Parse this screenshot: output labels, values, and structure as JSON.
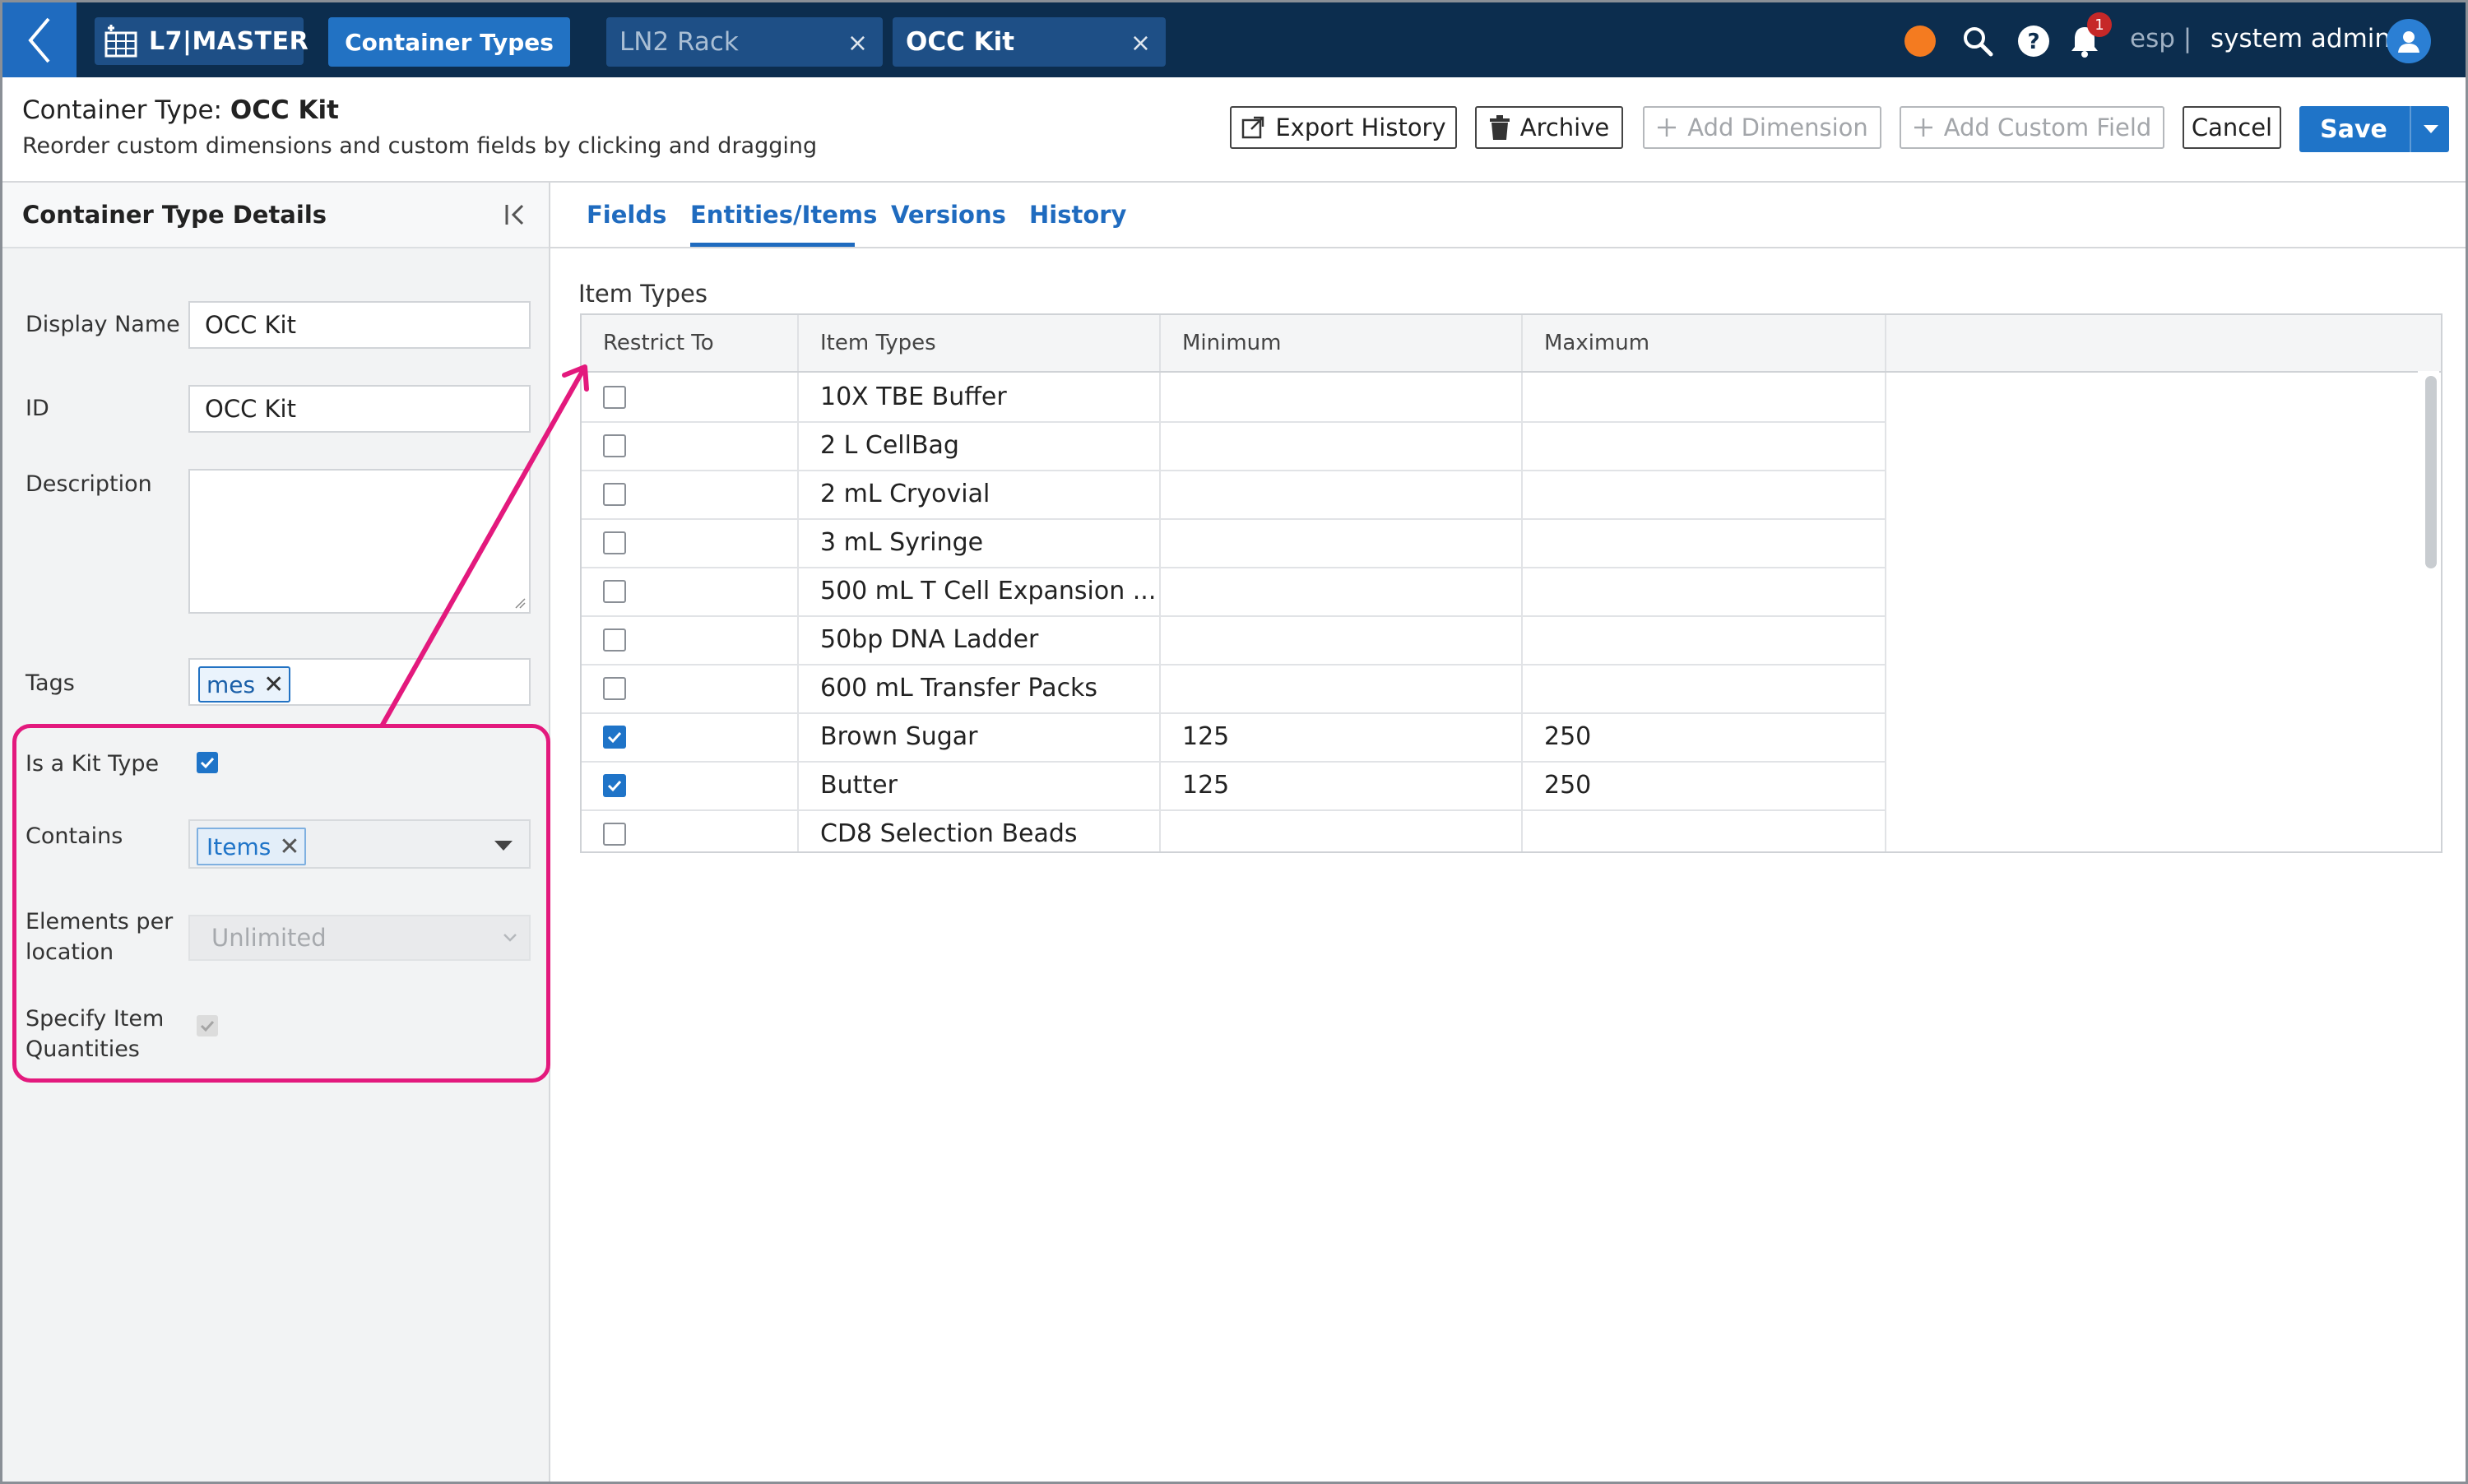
{
  "topbar": {
    "app_name": "L7|MASTER",
    "nav_tab": "Container Types",
    "open_tabs": [
      {
        "label": "LN2 Rack"
      },
      {
        "label": "OCC Kit"
      }
    ],
    "close_glyph": "×",
    "notification_count": "1",
    "workspace": "esp |",
    "user_name": "system admin",
    "icons": [
      "back-chevron-icon",
      "grid-logo-icon",
      "status-dot-icon",
      "search-icon",
      "help-icon",
      "bell-icon",
      "user-avatar-icon"
    ]
  },
  "header": {
    "title_prefix": "Container Type:",
    "title_name": "OCC Kit",
    "subtitle": "Reorder custom dimensions and custom fields by clicking and dragging",
    "buttons": {
      "export_history": "Export History",
      "archive": "Archive",
      "add_dimension": "Add Dimension",
      "add_custom_field": "Add Custom Field",
      "cancel": "Cancel",
      "save": "Save"
    }
  },
  "sidebar": {
    "title": "Container Type Details",
    "fields": {
      "display_name_label": "Display Name",
      "display_name_value": "OCC Kit",
      "id_label": "ID",
      "id_value": "OCC Kit",
      "description_label": "Description",
      "description_value": "",
      "tags_label": "Tags",
      "tag": "mes",
      "is_kit_label": "Is a Kit Type",
      "is_kit_checked": true,
      "contains_label": "Contains",
      "contains_value": "Items",
      "elements_label_1": "Elements per",
      "elements_label_2": "location",
      "elements_value": "Unlimited",
      "specify_label_1": "Specify Item",
      "specify_label_2": "Quantities",
      "specify_checked": true
    }
  },
  "main": {
    "tabs": [
      "Fields",
      "Entities/Items",
      "Versions",
      "History"
    ],
    "active_tab": "Entities/Items",
    "section_label": "Item Types",
    "columns": [
      "Restrict To",
      "Item Types",
      "Minimum",
      "Maximum"
    ],
    "rows": [
      {
        "checked": false,
        "name": "10X TBE Buffer",
        "min": "",
        "max": ""
      },
      {
        "checked": false,
        "name": "2 L CellBag",
        "min": "",
        "max": ""
      },
      {
        "checked": false,
        "name": "2 mL Cryovial",
        "min": "",
        "max": ""
      },
      {
        "checked": false,
        "name": "3 mL Syringe",
        "min": "",
        "max": ""
      },
      {
        "checked": false,
        "name": "500 mL T Cell Expansion ...",
        "min": "",
        "max": ""
      },
      {
        "checked": false,
        "name": "50bp DNA Ladder",
        "min": "",
        "max": ""
      },
      {
        "checked": false,
        "name": "600 mL Transfer Packs",
        "min": "",
        "max": ""
      },
      {
        "checked": true,
        "name": "Brown Sugar",
        "min": "125",
        "max": "250"
      },
      {
        "checked": true,
        "name": "Butter",
        "min": "125",
        "max": "250"
      },
      {
        "checked": false,
        "name": "CD8 Selection Beads",
        "min": "",
        "max": ""
      }
    ]
  },
  "colors": {
    "topbar": "#0c2d4e",
    "accent": "#1f74c8",
    "highlight": "#e3197d",
    "status_dot": "#f47b20",
    "badge": "#c62828"
  }
}
